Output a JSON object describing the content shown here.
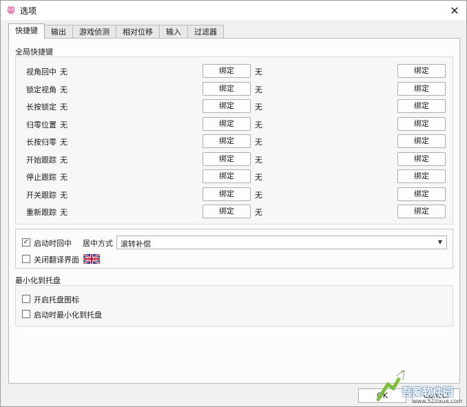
{
  "window": {
    "title": "选项",
    "close_glyph": "✕"
  },
  "tabs": [
    {
      "label": "快捷键",
      "active": true
    },
    {
      "label": "输出"
    },
    {
      "label": "游戏侦测"
    },
    {
      "label": "相对位移"
    },
    {
      "label": "输入"
    },
    {
      "label": "过滤器"
    }
  ],
  "hotkeys": {
    "group_title": "全局快捷键",
    "rows": [
      {
        "label": "视角回中",
        "primary": "无",
        "secondary": "无"
      },
      {
        "label": "锁定视角",
        "primary": "无",
        "secondary": "无"
      },
      {
        "label": "长按锁定",
        "primary": "无",
        "secondary": "无"
      },
      {
        "label": "归零位置",
        "primary": "无",
        "secondary": "无"
      },
      {
        "label": "长按归零",
        "primary": "无",
        "secondary": "无"
      },
      {
        "label": "开始跟踪",
        "primary": "无",
        "secondary": "无"
      },
      {
        "label": "停止跟踪",
        "primary": "无",
        "secondary": "无"
      },
      {
        "label": "开关跟踪",
        "primary": "无",
        "secondary": "无"
      },
      {
        "label": "重新跟踪",
        "primary": "无",
        "secondary": "无"
      }
    ],
    "bind_label": "绑定"
  },
  "options": {
    "center_on_start": {
      "label": "启动时回中",
      "checked": true
    },
    "center_mode_label": "居中方式",
    "center_mode_value": "滚转补偿",
    "close_translate": {
      "label": "关闭翻译界面",
      "checked": false
    },
    "flag_icon": "uk-flag-icon"
  },
  "tray": {
    "group_title": "最小化到托盘",
    "enable_tray": {
      "label": "开启托盘图标",
      "checked": false
    },
    "minimize_on_start": {
      "label": "启动时最小化到托盘",
      "checked": false
    }
  },
  "footer": {
    "ok_label": "OK",
    "cancel_label": "Cancel"
  },
  "watermark": {
    "text": "吾爱软件园",
    "url": "www.52zixue.com"
  },
  "colors": {
    "window_bg": "#f0f0f0",
    "panel_bg": "#fcfcfc",
    "border": "#adadad"
  }
}
